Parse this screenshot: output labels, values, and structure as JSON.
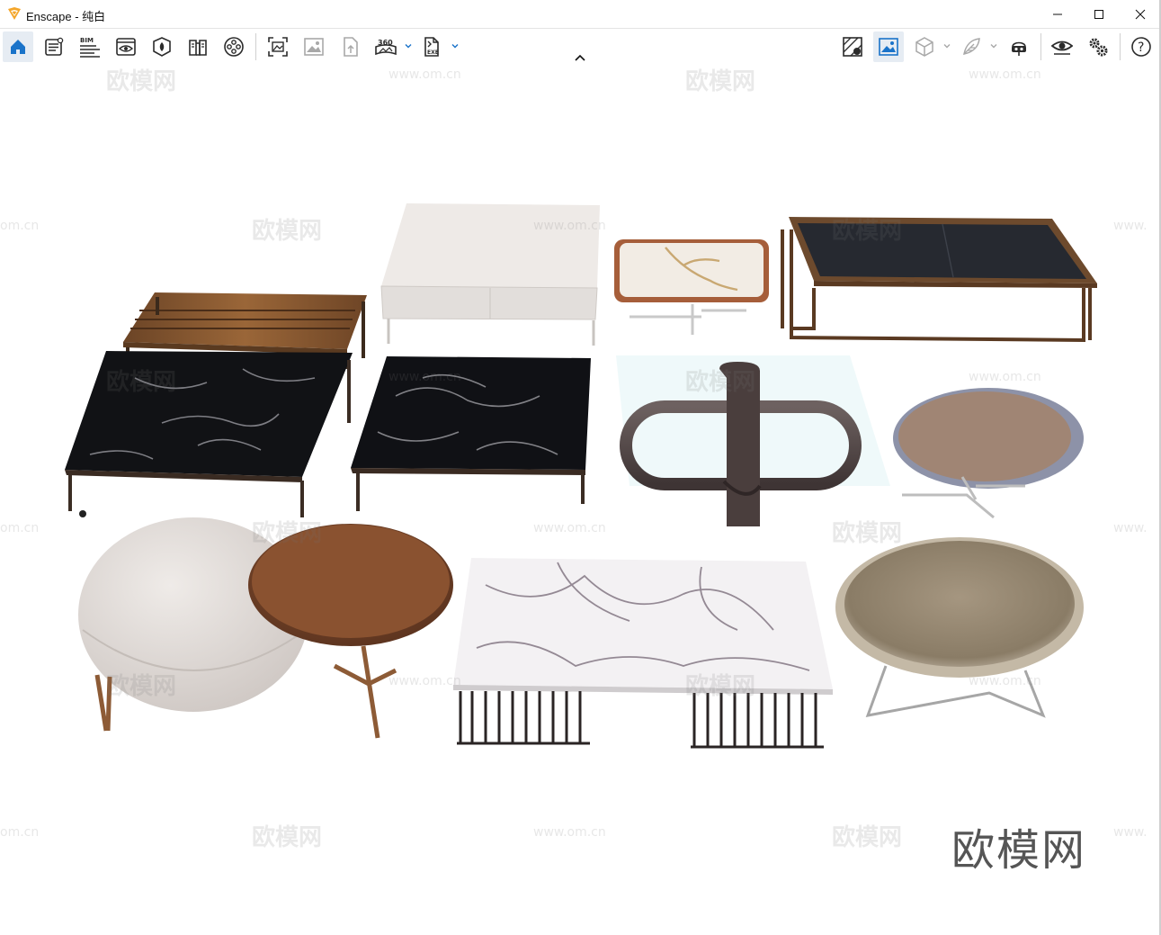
{
  "window": {
    "title": "Enscape - 纯白",
    "controls": [
      "minimize",
      "maximize",
      "close"
    ]
  },
  "toolbar": {
    "left_icons": [
      "home-icon",
      "batch-render-icon",
      "bim-icon",
      "view-icon",
      "material-icon",
      "book-icon",
      "video-icon",
      "screenshot-icon",
      "image-icon",
      "upload-icon",
      "panorama-360-icon",
      "exe-export-icon"
    ],
    "bim_label": "BIM",
    "panorama_label": "360",
    "exe_label": "EXE",
    "right_icons": [
      "asset-map-icon",
      "visual-settings-image-icon",
      "cube-icon",
      "feather-icon",
      "vr-headset-icon",
      "eye-icon",
      "settings-gears-icon",
      "help-icon"
    ],
    "help_label": "?"
  },
  "viewport": {
    "watermark_text": "欧模网",
    "watermark_url": "www.om.cn",
    "watermark_url_partial": "om.cn",
    "watermark_url_edge": "www.",
    "brand_text": "欧模网"
  },
  "colors": {
    "accent": "#1a73c9",
    "logo": "#f4a62a",
    "icon": "#2b2b2b",
    "disabled_icon": "#a8a8a8"
  }
}
